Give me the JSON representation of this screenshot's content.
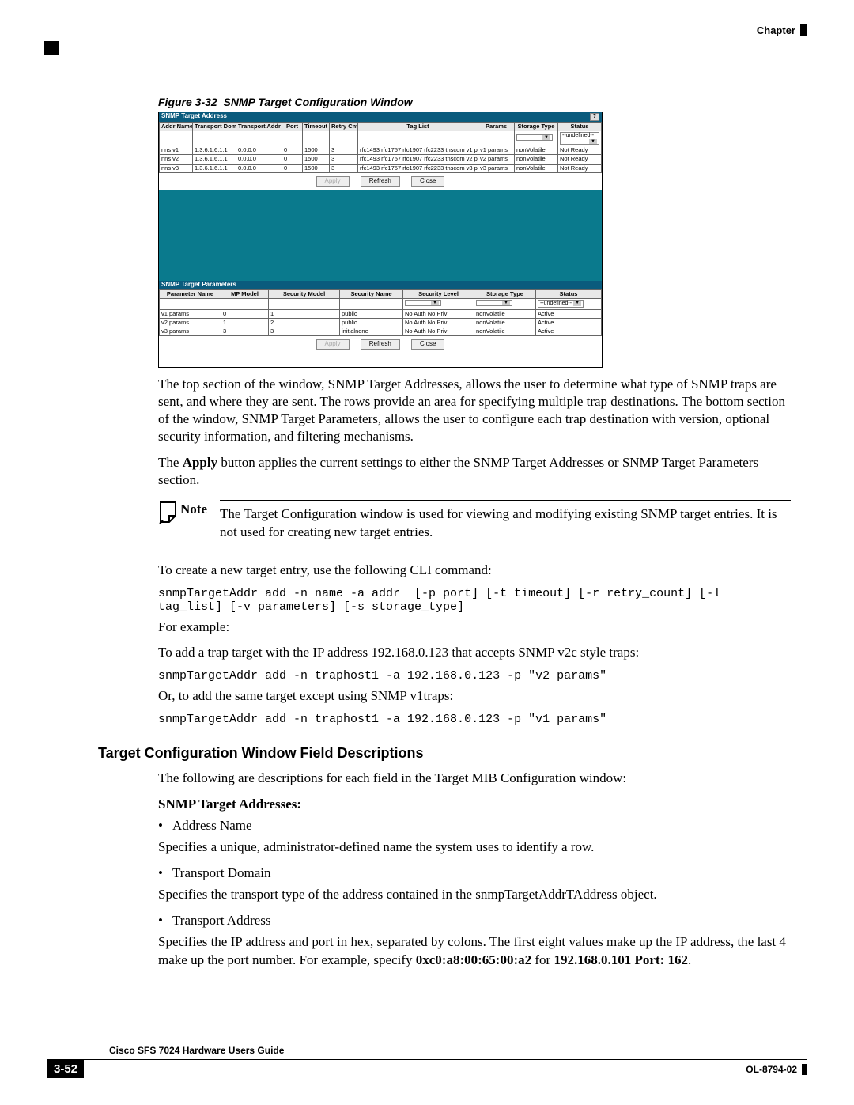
{
  "header": {
    "chapter": "Chapter"
  },
  "figure": {
    "label": "Figure 3-32",
    "title": "SNMP Target Configuration Window"
  },
  "window": {
    "addr_section_title": "SNMP Target Address",
    "help_label": "?",
    "addr_headers": [
      "Addr Name",
      "Transport Dom",
      "Transport Addr",
      "Port",
      "Timeout",
      "Retry Cnt",
      "Tag List",
      "Params",
      "Storage Type",
      "Status"
    ],
    "addr_dropdown_undefined": "--undefined--",
    "addr_rows": [
      {
        "name": "nns v1",
        "dom": "1.3.6.1.6.1.1",
        "addr": "0.0.0.0",
        "port": "0",
        "timeout": "1500",
        "retry": "3",
        "tags": "rfc1493 rfc1757 rfc1907 rfc2233 tnscom",
        "params": "v1 params",
        "storage": "nonVolatile",
        "status": "Not Ready"
      },
      {
        "name": "nns v2",
        "dom": "1.3.6.1.6.1.1",
        "addr": "0.0.0.0",
        "port": "0",
        "timeout": "1500",
        "retry": "3",
        "tags": "rfc1493 rfc1757 rfc1907 rfc2233 tnscom",
        "params": "v2 params",
        "storage": "nonVolatile",
        "status": "Not Ready"
      },
      {
        "name": "nns v3",
        "dom": "1.3.6.1.6.1.1",
        "addr": "0.0.0.0",
        "port": "0",
        "timeout": "1500",
        "retry": "3",
        "tags": "rfc1493 rfc1757 rfc1907 rfc2233 tnscom",
        "params": "v3 params",
        "storage": "nonVolatile",
        "status": "Not Ready"
      }
    ],
    "buttons": {
      "apply": "Apply",
      "refresh": "Refresh",
      "close": "Close"
    },
    "params_section_title": "SNMP Target Parameters",
    "params_headers": [
      "Parameter Name",
      "MP Model",
      "Security Model",
      "Security Name",
      "Security Level",
      "Storage Type",
      "Status"
    ],
    "params_rows": [
      {
        "name": "v1 params",
        "mp": "0",
        "sm": "1",
        "sname": "public",
        "slevel": "No Auth No Priv",
        "storage": "nonVolatile",
        "status": "Active"
      },
      {
        "name": "v2 params",
        "mp": "1",
        "sm": "2",
        "sname": "public",
        "slevel": "No Auth No Priv",
        "storage": "nonVolatile",
        "status": "Active"
      },
      {
        "name": "v3 params",
        "mp": "3",
        "sm": "3",
        "sname": "initialnone",
        "slevel": "No Auth No Priv",
        "storage": "nonVolatile",
        "status": "Active"
      }
    ]
  },
  "paras": {
    "p1": "The top section of the window, SNMP Target Addresses, allows the user to determine what type of SNMP traps are sent, and where they are sent. The rows provide an area for specifying multiple trap destinations. The bottom section of the window, SNMP Target Parameters, allows the user to configure each trap destination with version, optional security information, and filtering mechanisms.",
    "p2_pre": "The ",
    "p2_bold": "Apply",
    "p2_post": " button applies the current settings to either the SNMP Target Addresses or SNMP Target Parameters section.",
    "note_label": "Note",
    "note_text": "The Target Configuration window is used for viewing and modifying existing SNMP target entries. It is not used for creating new target entries.",
    "p3": "To create a new target entry, use the following CLI command:",
    "code1": "snmpTargetAddr add -n name -a addr  [-p port] [-t timeout] [-r retry_count] [-l tag_list] [-v parameters] [-s storage_type]",
    "p4": "For example:",
    "p5": "To add a trap target with the IP address 192.168.0.123 that accepts SNMP v2c style traps:",
    "code2": "snmpTargetAddr add -n traphost1 -a 192.168.0.123 -p \"v2 params\"",
    "p6": "Or, to add the same target except using SNMP v1traps:",
    "code3": "snmpTargetAddr add -n traphost1 -a 192.168.0.123 -p \"v1 params\""
  },
  "section": {
    "heading": "Target Configuration Window Field Descriptions",
    "intro": "The following are descriptions for each field in the Target MIB Configuration window:",
    "sub": "SNMP Target Addresses:",
    "items": [
      {
        "term": "Address Name",
        "desc": "Specifies a unique, administrator-defined name the system uses to identify a row."
      },
      {
        "term": "Transport Domain",
        "desc": "Specifies the transport type of the address contained in the snmpTargetAddrTAddress object."
      },
      {
        "term": "Transport Address",
        "desc_pre": "Specifies the IP address and port in hex, separated by colons. The first eight values make up the IP address, the last 4 make up the port number. For example, specify ",
        "desc_b1": "0xc0:a8:00:65:00:a2",
        "desc_mid": " for ",
        "desc_b2": "192.168.0.101 Port: 162",
        "desc_post": "."
      }
    ]
  },
  "footer": {
    "book": "Cisco SFS 7024 Hardware Users Guide",
    "page": "3-52",
    "docid": "OL-8794-02"
  }
}
